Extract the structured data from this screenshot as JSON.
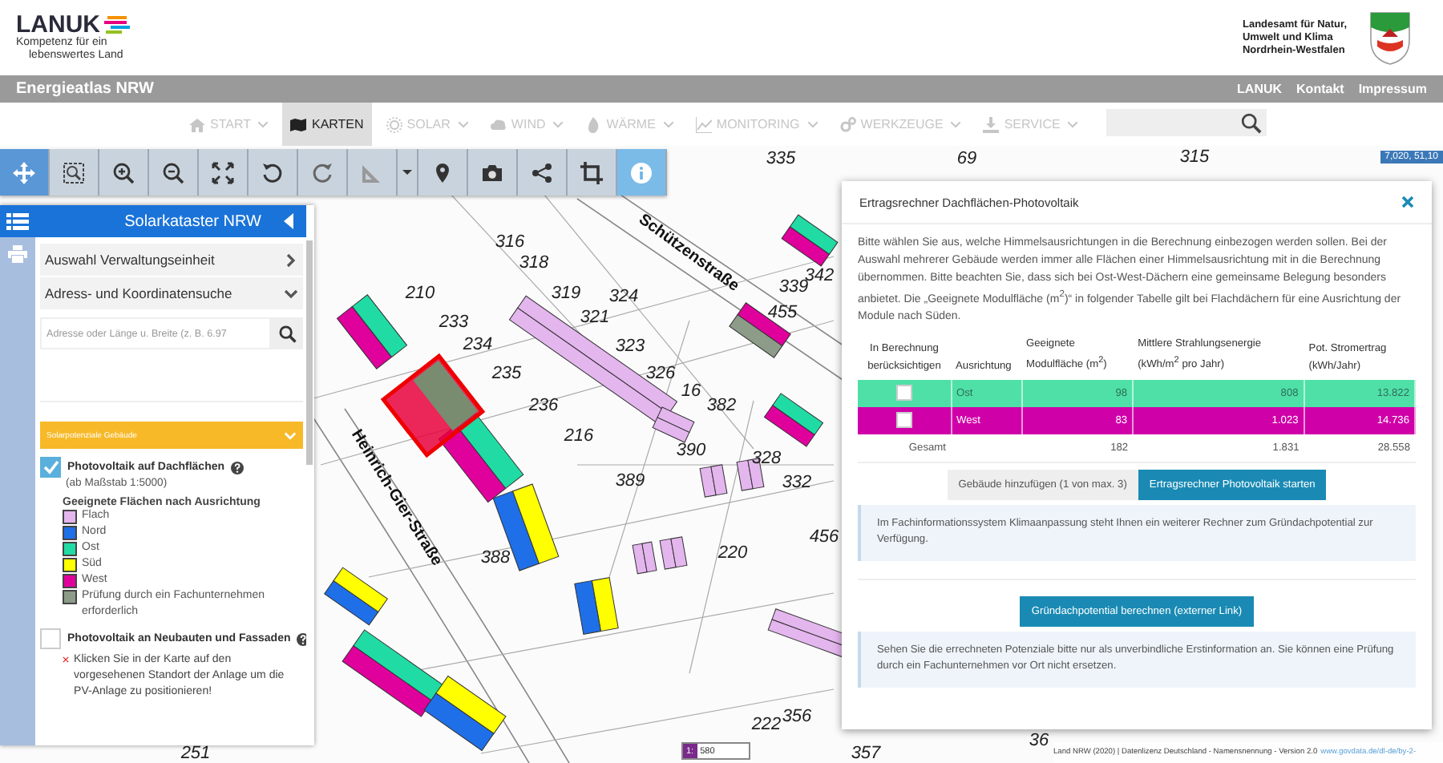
{
  "header": {
    "logo": "LANUK",
    "tagline_lines": [
      "Kompetenz für ein",
      "lebenswertes Land"
    ],
    "agency_lines": [
      "Landesamt für Natur,",
      "Umwelt und Klima",
      "Nordrhein-Westfalen"
    ]
  },
  "topbar": {
    "title": "Energieatlas NRW",
    "links": [
      "LANUK",
      "Kontakt",
      "Impressum"
    ]
  },
  "nav": {
    "items": [
      {
        "label": "START",
        "selected": false,
        "dropdown": true
      },
      {
        "label": "KARTEN",
        "selected": true,
        "dropdown": false
      },
      {
        "label": "SOLAR",
        "selected": false,
        "dropdown": true
      },
      {
        "label": "WIND",
        "selected": false,
        "dropdown": true
      },
      {
        "label": "WÄRME",
        "selected": false,
        "dropdown": true
      },
      {
        "label": "MONITORING",
        "selected": false,
        "dropdown": true
      },
      {
        "label": "WERKZEUGE",
        "selected": false,
        "dropdown": true
      },
      {
        "label": "SERVICE",
        "selected": false,
        "dropdown": true
      }
    ]
  },
  "toolbar": {
    "tools": [
      {
        "selected": true
      },
      {
        "selected": false
      },
      {
        "selected": false
      },
      {
        "selected": false
      },
      {
        "selected": false
      },
      {
        "selected": false
      },
      {
        "selected": false
      },
      {
        "selected": false
      },
      {
        "selected": false
      },
      {
        "selected": false
      },
      {
        "selected": false
      },
      {
        "selected": false
      },
      {
        "selected": false
      },
      {
        "selected": true
      }
    ]
  },
  "panel": {
    "title": "Solarkataster NRW",
    "sections": [
      {
        "label": "Auswahl Verwaltungseinheit",
        "expanded": false
      },
      {
        "label": "Adress- und Koordinatensuche",
        "expanded": true
      }
    ],
    "search": {
      "placeholder": "Adresse oder Länge u. Breite (z. B. 6.97"
    },
    "group": {
      "label": "Solarpotenziale Gebäude",
      "expanded": true
    },
    "layers": [
      {
        "label": "Photovoltaik auf Dachflächen",
        "checked": true,
        "note": "(ab Maßstab 1:5000)"
      },
      {
        "label": "Photovoltaik an Neubauten und Fassaden",
        "checked": false
      }
    ],
    "legend": {
      "title": "Geeignete Flächen nach Ausrichtung",
      "items": [
        {
          "label": "Flach",
          "color": "#e4b6ee"
        },
        {
          "label": "Nord",
          "color": "#1f6fe8"
        },
        {
          "label": "Ost",
          "color": "#20dca4"
        },
        {
          "label": "Süd",
          "color": "#ffff00"
        },
        {
          "label": "West",
          "color": "#e0009c"
        },
        {
          "label": "Prüfung durch ein Fachunternehmen erforderlich",
          "color": "#8c9c88"
        }
      ]
    },
    "hint": "Klicken Sie in der Karte auf den vorgesehenen Standort der Anlage um die PV-Anlage zu positionieren!"
  },
  "dialog": {
    "title": "Ertragsrechner Dachflächen-Photovoltaik",
    "intro": "Bitte wählen Sie aus, welche Himmelsausrichtungen in die Berechnung einbezogen werden sollen. Bei der Auswahl mehrerer Gebäude werden immer alle Flächen einer Himmelsausrichtung mit in die Berechnung übernommen. Bitte beachten Sie, dass sich bei Ost-West-Dächern eine gemeinsame Belegung besonders anbietet. Die „Geeignete Modulfläche (m$^{2}$)“ in folgender Tabelle gilt bei Flachdächern für eine Ausrichtung der Module nach Süden.",
    "table": {
      "columns": [
        "In Berechnung berücksichtigen",
        "Ausrichtung",
        "Geeignete Modulfläche (m$^{2}$)",
        "Mittlere Strahlungsenergie (kWh/m$^{2}$ pro Jahr)",
        "Pot. Stromertrag (kWh/Jahr)"
      ],
      "rows": [
        {
          "checked": false,
          "color": "#4fe0a8",
          "name": "Ost",
          "area": "98",
          "energy": "808",
          "yield": "13.822"
        },
        {
          "checked": false,
          "color": "#d000a8",
          "name": "West",
          "area": "83",
          "energy": "1.023",
          "yield": "14.736"
        }
      ],
      "total": {
        "label": "Gesamt",
        "area": "182",
        "energy": "1.831",
        "yield": "28.558"
      }
    },
    "buttons": [
      {
        "label": "Gebäude hinzufügen (1 von max. 3)",
        "kind": "secondary"
      },
      {
        "label": "Ertragsrechner Photovoltaik starten",
        "kind": "primary"
      }
    ],
    "info_1": "Im Fachinformationssystem Klimaanpassung steht Ihnen ein weiterer Rechner zum Gründachpotential zur Verfügung.",
    "link_button": "Gründachpotential berechnen (externer Link)",
    "info_2": "Sehen Sie die errechneten Potenziale bitte nur als unverbindliche Erstinformation an. Sie können eine Prüfung durch ein Fachunternehmen vor Ort nicht ersetzen."
  },
  "map": {
    "labels": [
      "335",
      "69",
      "315",
      "316",
      "318",
      "319",
      "324",
      "321",
      "323",
      "326",
      "16",
      "382",
      "339",
      "342",
      "455",
      "210",
      "233",
      "234",
      "235",
      "236",
      "216",
      "390",
      "389",
      "328",
      "332",
      "388",
      "220",
      "456",
      "356",
      "222",
      "251",
      "36",
      "357",
      "Schützenstraße",
      "Heinrich-Gier-Straße"
    ],
    "coordinates": "7,020, 51,10",
    "scale": "1: 580",
    "attribution": "Land NRW (2020) | Datenlizenz Deutschland - Namensnennung - Version 2.0",
    "attribution_link": "www.govdata.de/dl-de/by-2-"
  }
}
